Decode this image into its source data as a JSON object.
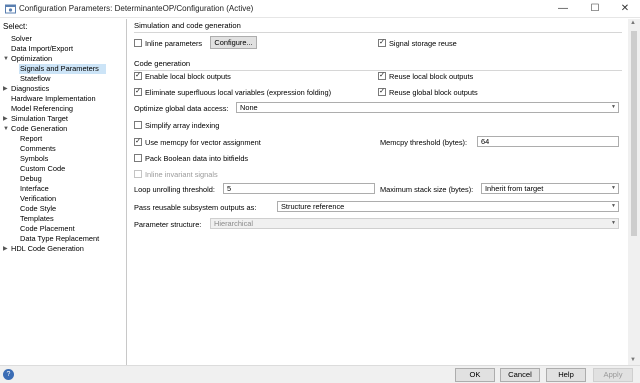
{
  "window": {
    "title": "Configuration Parameters: DeterminanteOP/Configuration (Active)",
    "min_glyph": "—",
    "max_glyph": "☐",
    "close_glyph": "✕",
    "app_icon": "gear-icon"
  },
  "tree": {
    "header": "Select:",
    "items": [
      {
        "label": "Solver"
      },
      {
        "label": "Data Import/Export"
      },
      {
        "label": "Optimization",
        "expander": "▼"
      },
      {
        "label": "Signals and Parameters",
        "selected": true
      },
      {
        "label": "Stateflow"
      },
      {
        "label": "Diagnostics",
        "expander": "▶"
      },
      {
        "label": "Hardware Implementation"
      },
      {
        "label": "Model Referencing"
      },
      {
        "label": "Simulation Target",
        "expander": "▶"
      },
      {
        "label": "Code Generation",
        "expander": "▼"
      },
      {
        "label": "Report"
      },
      {
        "label": "Comments"
      },
      {
        "label": "Symbols"
      },
      {
        "label": "Custom Code"
      },
      {
        "label": "Debug"
      },
      {
        "label": "Interface"
      },
      {
        "label": "Verification"
      },
      {
        "label": "Code Style"
      },
      {
        "label": "Templates"
      },
      {
        "label": "Code Placement"
      },
      {
        "label": "Data Type Replacement"
      },
      {
        "label": "HDL Code Generation",
        "expander": "▶"
      }
    ]
  },
  "sim_group": {
    "title": "Simulation and code generation",
    "inline_parameters": {
      "label": "Inline parameters",
      "checked": false
    },
    "configure_label": "Configure...",
    "signal_storage_reuse": {
      "label": "Signal storage reuse",
      "checked": true
    }
  },
  "code_group": {
    "title": "Code generation",
    "enable_local_block_outputs": {
      "label": "Enable local block outputs",
      "checked": true
    },
    "reuse_local_block_outputs": {
      "label": "Reuse local block outputs",
      "checked": true
    },
    "eliminate_superfluous": {
      "label": "Eliminate superfluous local variables (expression folding)",
      "checked": true
    },
    "reuse_global_block_outputs": {
      "label": "Reuse global block outputs",
      "checked": true
    },
    "optimize_global_label": "Optimize global data access:",
    "optimize_global_value": "None",
    "simplify_array_indexing": {
      "label": "Simplify array indexing",
      "checked": false
    },
    "use_memcpy": {
      "label": "Use memcpy for vector assignment",
      "checked": true
    },
    "memcpy_threshold_label": "Memcpy threshold (bytes):",
    "memcpy_threshold_value": "64",
    "pack_boolean": {
      "label": "Pack Boolean data into bitfields",
      "checked": false
    },
    "inline_invariant": {
      "label": "Inline invariant signals",
      "checked": false,
      "disabled": true
    },
    "loop_unrolling_label": "Loop unrolling threshold:",
    "loop_unrolling_value": "5",
    "max_stack_label": "Maximum stack size (bytes):",
    "max_stack_value": "Inherit from target",
    "pass_reusable_label": "Pass reusable subsystem outputs as:",
    "pass_reusable_value": "Structure reference",
    "parameter_structure_label": "Parameter structure:",
    "parameter_structure_value": "Hierarchical"
  },
  "footer": {
    "help_icon_glyph": "?",
    "ok": "OK",
    "cancel": "Cancel",
    "help": "Help",
    "apply": "Apply"
  },
  "glyphs": {
    "check": "✓",
    "dropdown": "▼",
    "scroll_up": "▲",
    "scroll_down": "▼"
  },
  "colors": {
    "selection": "#cce4f7",
    "help_icon": "#3b6db5"
  }
}
